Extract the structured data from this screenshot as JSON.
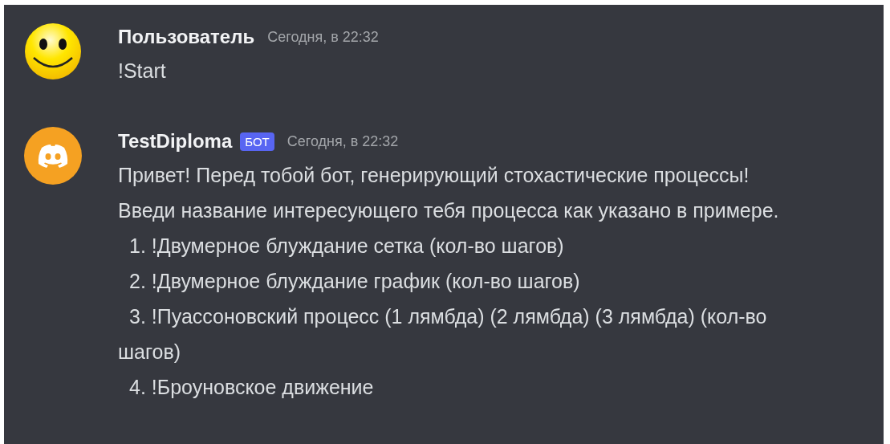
{
  "messages": [
    {
      "author": "Пользователь",
      "avatar": {
        "kind": "smiley"
      },
      "timestamp": "Сегодня, в 22:32",
      "paragraphs": [
        "!Start"
      ]
    },
    {
      "author": "TestDiploma",
      "avatar": {
        "kind": "discord"
      },
      "bot_badge": "БОТ",
      "timestamp": "Сегодня, в 22:32",
      "paragraphs": [
        "Привет! Перед тобой бот, генерирующий стохастические процессы! Введи название интересующего тебя процесса как указано в примере."
      ],
      "items": [
        "1. !Двумерное блуждание сетка (кол-во шагов)",
        "2. !Двумерное блуждание график (кол-во шагов)",
        "3. !Пуассоновский процесс (1 лямбда) (2 лямбда) (3 лямбда) (кол-во шагов)",
        "4. !Броуновское движение"
      ]
    }
  ]
}
